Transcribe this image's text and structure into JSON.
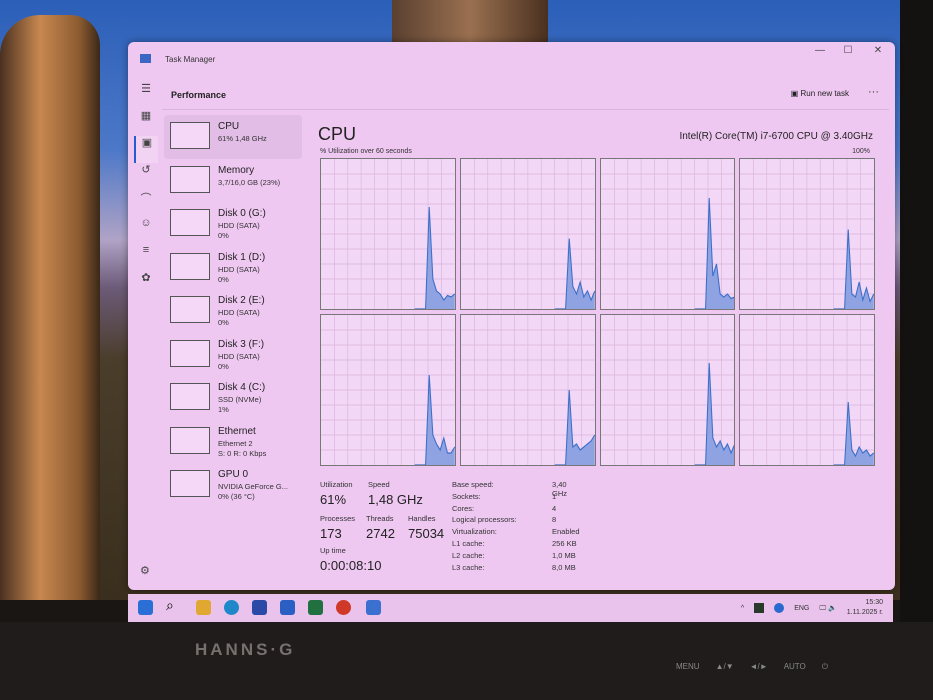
{
  "window": {
    "title": "Task Manager",
    "minimize": "—",
    "maximize": "☐",
    "close": "✕"
  },
  "header": {
    "title": "Performance",
    "run_new_task": "Run new task",
    "more": "···"
  },
  "sidebar": [
    {
      "name": "CPU",
      "sub1": "61% 1,48 GHz",
      "sub2": ""
    },
    {
      "name": "Memory",
      "sub1": "3,7/16,0 GB (23%)",
      "sub2": ""
    },
    {
      "name": "Disk 0 (G:)",
      "sub1": "HDD (SATA)",
      "sub2": "0%"
    },
    {
      "name": "Disk 1 (D:)",
      "sub1": "HDD (SATA)",
      "sub2": "0%"
    },
    {
      "name": "Disk 2 (E:)",
      "sub1": "HDD (SATA)",
      "sub2": "0%"
    },
    {
      "name": "Disk 3 (F:)",
      "sub1": "HDD (SATA)",
      "sub2": "0%"
    },
    {
      "name": "Disk 4 (C:)",
      "sub1": "SSD (NVMe)",
      "sub2": "1%"
    },
    {
      "name": "Ethernet",
      "sub1": "Ethernet 2",
      "sub2": "S: 0 R: 0 Kbps"
    },
    {
      "name": "GPU 0",
      "sub1": "NVIDIA GeForce G...",
      "sub2": "0% (36 °C)"
    }
  ],
  "main": {
    "title": "CPU",
    "model": "Intel(R) Core(TM) i7-6700 CPU @ 3.40GHz",
    "util_label": "% Utilization over 60 seconds",
    "max_label": "100%"
  },
  "chart_data": {
    "type": "area",
    "title": "% Utilization over 60 seconds",
    "ylim": [
      0,
      100
    ],
    "xlabel": "seconds",
    "series": [
      {
        "name": "core0",
        "values": [
          0,
          0,
          0,
          0,
          68,
          20,
          12,
          10,
          6,
          9,
          8,
          10
        ]
      },
      {
        "name": "core1",
        "values": [
          0,
          0,
          0,
          0,
          47,
          15,
          10,
          18,
          8,
          12,
          6,
          12
        ]
      },
      {
        "name": "core2",
        "values": [
          0,
          0,
          0,
          0,
          74,
          22,
          30,
          10,
          8,
          10,
          7,
          8
        ]
      },
      {
        "name": "core3",
        "values": [
          0,
          0,
          0,
          0,
          53,
          10,
          8,
          18,
          6,
          14,
          5,
          10
        ]
      },
      {
        "name": "core4",
        "values": [
          0,
          0,
          0,
          0,
          60,
          20,
          14,
          10,
          18,
          8,
          8,
          12
        ]
      },
      {
        "name": "core5",
        "values": [
          0,
          0,
          0,
          0,
          50,
          12,
          14,
          10,
          12,
          14,
          16,
          20
        ]
      },
      {
        "name": "core6",
        "values": [
          0,
          0,
          0,
          0,
          68,
          18,
          12,
          16,
          10,
          14,
          8,
          14
        ]
      },
      {
        "name": "core7",
        "values": [
          0,
          0,
          0,
          0,
          42,
          10,
          6,
          12,
          8,
          10,
          6,
          8
        ]
      }
    ]
  },
  "stats": {
    "utilization_label": "Utilization",
    "utilization": "61%",
    "speed_label": "Speed",
    "speed": "1,48 GHz",
    "processes_label": "Processes",
    "processes": "173",
    "threads_label": "Threads",
    "threads": "2742",
    "handles_label": "Handles",
    "handles": "75034",
    "uptime_label": "Up time",
    "uptime": "0:00:08:10"
  },
  "specs": [
    {
      "k": "Base speed:",
      "v": "3,40 GHz"
    },
    {
      "k": "Sockets:",
      "v": "1"
    },
    {
      "k": "Cores:",
      "v": "4"
    },
    {
      "k": "Logical processors:",
      "v": "8"
    },
    {
      "k": "Virtualization:",
      "v": "Enabled"
    },
    {
      "k": "L1 cache:",
      "v": "256 KB"
    },
    {
      "k": "L2 cache:",
      "v": "1,0 MB"
    },
    {
      "k": "L3 cache:",
      "v": "8,0 MB"
    }
  ],
  "tray": {
    "lang": "ENG",
    "time": "15:30",
    "date": "1.11.2025 г.",
    "chevron": "^"
  },
  "monitor": {
    "brand": "HANNS·G",
    "buttons": [
      "MENU",
      "▲/▼",
      "◄/►",
      "AUTO",
      "⏻"
    ]
  },
  "colors": {
    "accent": "#2a5bd0",
    "graph_line": "#3c6fc8",
    "graph_fill": "#8fa3e3"
  }
}
